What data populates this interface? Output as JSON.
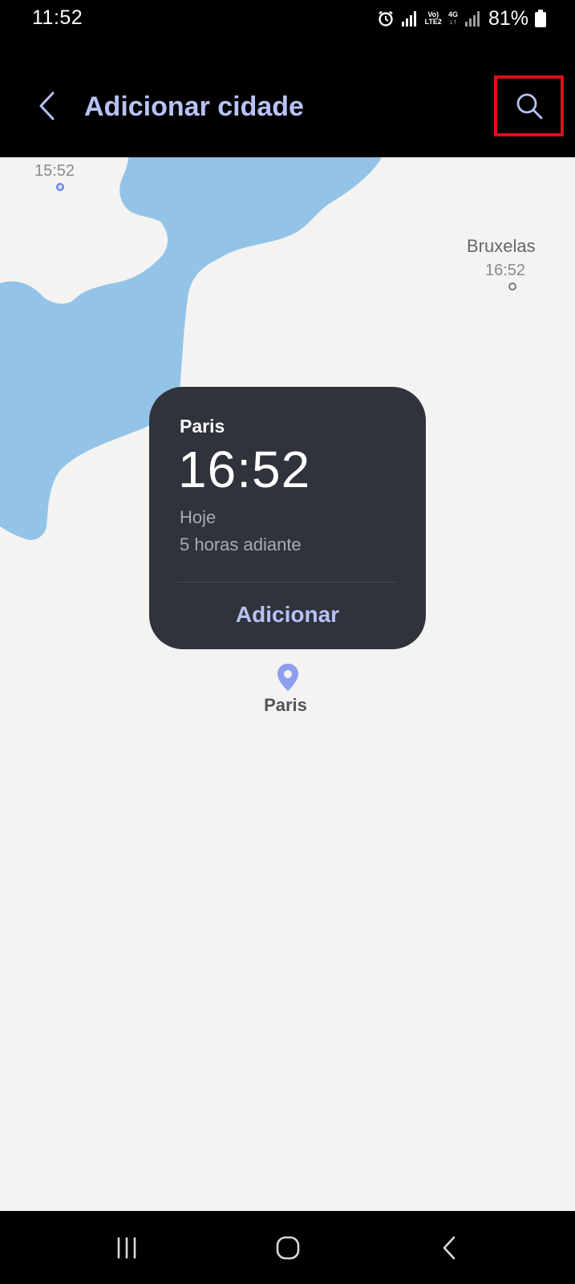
{
  "status_bar": {
    "time": "11:52",
    "volte_label_top": "Vo)",
    "volte_label_bottom": "LTE2",
    "network_type": "4G",
    "battery": "81%"
  },
  "app_bar": {
    "title": "Adicionar cidade",
    "back_icon": "chevron-left-icon",
    "search_icon": "search-icon"
  },
  "map": {
    "markers": [
      {
        "time": "15:52"
      },
      {
        "city": "Bruxelas",
        "time": "16:52"
      }
    ]
  },
  "city_card": {
    "city": "Paris",
    "time": "16:52",
    "day": "Hoje",
    "offset": "5 horas adiante",
    "add_label": "Adicionar"
  },
  "pin": {
    "label": "Paris"
  },
  "nav_bar": {
    "recents_icon": "recents-icon",
    "home_icon": "home-icon",
    "back_icon": "back-icon"
  },
  "colors": {
    "accent": "#b7c2f5",
    "water": "#93c4e7",
    "land": "#f4f3f1",
    "card": "#30323c",
    "highlight": "#e10d1b"
  }
}
